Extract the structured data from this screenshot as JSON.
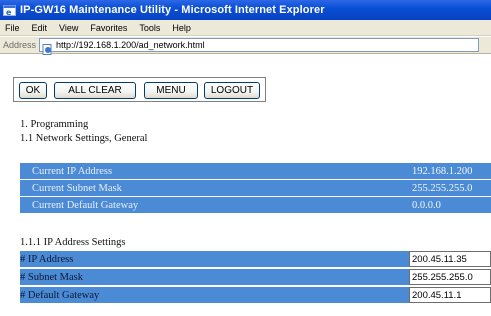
{
  "window": {
    "title": "IP-GW16 Maintenance Utility - Microsoft Internet Explorer"
  },
  "menu": {
    "items": [
      {
        "label": "File"
      },
      {
        "label": "Edit"
      },
      {
        "label": "View"
      },
      {
        "label": "Favorites"
      },
      {
        "label": "Tools"
      },
      {
        "label": "Help"
      }
    ]
  },
  "address_bar": {
    "label": "Address",
    "url": "http://192.168.1.200/ad_network.html"
  },
  "toolbar": {
    "ok_label": "OK",
    "all_clear_label": "ALL CLEAR",
    "menu_label": "MENU",
    "logout_label": "LOGOUT"
  },
  "headings": {
    "programming": "1. Programming",
    "network_general": "1.1 Network Settings, General",
    "ip_settings": "1.1.1 IP Address Settings"
  },
  "current": {
    "rows": [
      {
        "label": "Current IP Address",
        "value": "192.168.1.200"
      },
      {
        "label": "Current Subnet Mask",
        "value": "255.255.255.0"
      },
      {
        "label": "Current Default Gateway",
        "value": "0.0.0.0"
      }
    ]
  },
  "settings": {
    "rows": [
      {
        "label": "# IP Address",
        "value": "200.45.11.35"
      },
      {
        "label": "# Subnet Mask",
        "value": "255.255.255.0"
      },
      {
        "label": "# Default Gateway",
        "value": "200.45.11.1"
      }
    ]
  },
  "colors": {
    "row_blue": "#4b8bd6",
    "titlebar_blue": "#0a4fd6"
  }
}
